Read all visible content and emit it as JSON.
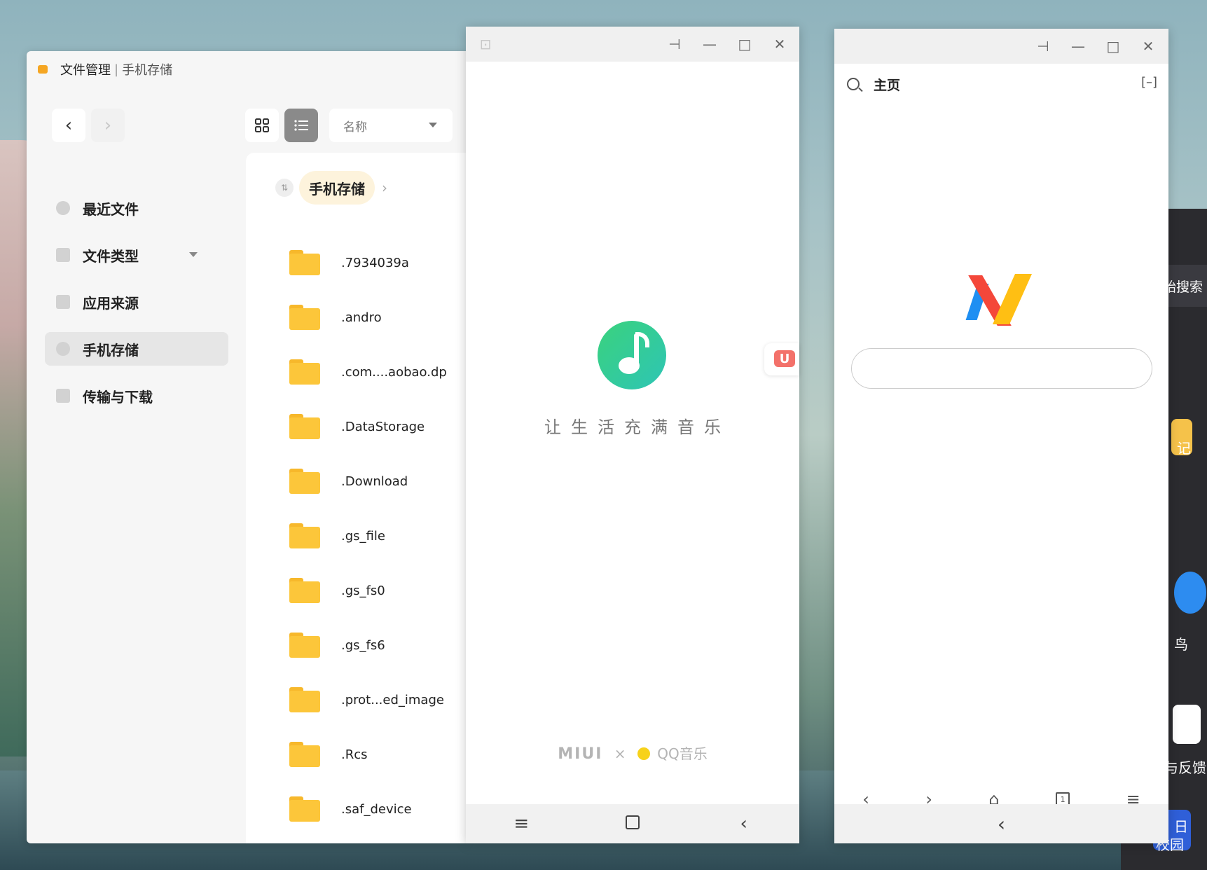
{
  "background": {
    "right_app": {
      "search_text": "始搜索",
      "labels": [
        "记",
        "鸟",
        "与反馈",
        "日",
        "校园"
      ]
    }
  },
  "file_manager": {
    "title": "文件管理",
    "separator": "|",
    "subtitle": "手机存储",
    "toolbar": {
      "back_icon": "chevron-left-icon",
      "forward_icon": "chevron-right-icon",
      "grid_icon": "grid-view-icon",
      "list_icon": "list-view-icon",
      "sort_value": "名称"
    },
    "sidebar": [
      {
        "label": "最近文件",
        "icon": "clock-icon"
      },
      {
        "label": "文件类型",
        "icon": "folder-type-icon",
        "has_dropdown": true
      },
      {
        "label": "应用来源",
        "icon": "apps-icon"
      },
      {
        "label": "手机存储",
        "icon": "storage-icon",
        "selected": true
      },
      {
        "label": "传输与下载",
        "icon": "transfer-icon"
      }
    ],
    "breadcrumb": {
      "current": "手机存储"
    },
    "files": [
      ".7934039a",
      ".andro",
      ".com....aobao.dp",
      ".DataStorage",
      ".Download",
      ".gs_file",
      ".gs_fs0",
      ".gs_fs6",
      ".prot...ed_image",
      ".Rcs",
      ".saf_device"
    ]
  },
  "music_window": {
    "titlebar_icons": [
      "pin-icon",
      "minimize-icon",
      "maximize-icon",
      "close-icon"
    ],
    "slogan": "让生活充满音乐",
    "footer_brand": "MIUI",
    "footer_x": "×",
    "footer_partner": "QQ音乐",
    "float_badge": "U"
  },
  "browser_window": {
    "titlebar_icons": [
      "pin-icon",
      "minimize-icon",
      "maximize-icon",
      "close-icon"
    ],
    "top_title": "主页",
    "expand_label": "[–]",
    "tab_count": "1"
  },
  "colors": {
    "folder": "#fcc63a",
    "selected_sidebar": "#e6e6e6",
    "music_logo": "#2ec5b5",
    "via_blue": "#1f8ff2",
    "via_red": "#f4473a",
    "via_yellow": "#ffbf13"
  }
}
